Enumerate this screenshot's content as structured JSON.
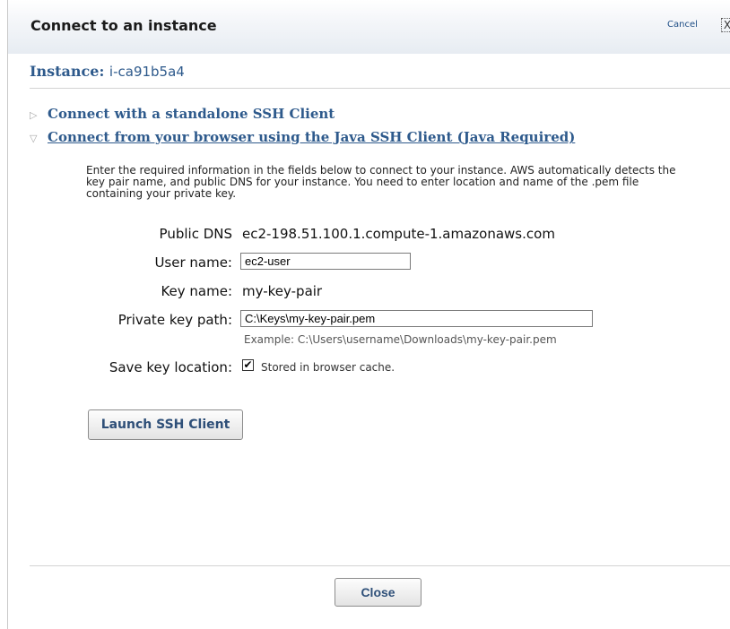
{
  "dialog": {
    "title": "Connect to an instance",
    "cancel_label": "Cancel",
    "close_x": "X"
  },
  "instance": {
    "label": "Instance:",
    "id": "i-ca91b5a4"
  },
  "sections": [
    {
      "label": "Connect with a standalone SSH Client",
      "expanded": false,
      "arrow": "▷"
    },
    {
      "label": "Connect from your browser using the Java SSH Client (Java Required)",
      "expanded": true,
      "arrow": "▽"
    }
  ],
  "description": "Enter the required information in the fields below to connect to your instance. AWS automatically detects the key pair name, and public DNS for your instance. You need to enter location and name of the .pem file containing your private key.",
  "form": {
    "public_dns_label": "Public DNS",
    "public_dns_value": "ec2-198.51.100.1.compute-1.amazonaws.com",
    "user_name_label": "User name:",
    "user_name_value": "ec2-user",
    "key_name_label": "Key name:",
    "key_name_value": "my-key-pair",
    "private_key_label": "Private key path:",
    "private_key_value": "C:\\Keys\\my-key-pair.pem",
    "private_key_example": "Example: C:\\Users\\username\\Downloads\\my-key-pair.pem",
    "save_key_label": "Save key location:",
    "save_key_checked": true,
    "save_key_checkmark": "✔",
    "save_key_text": "Stored in browser cache."
  },
  "buttons": {
    "launch": "Launch SSH Client",
    "close": "Close"
  },
  "colors": {
    "link_blue": "#2e5a8c",
    "button_text": "#2e4f78"
  }
}
